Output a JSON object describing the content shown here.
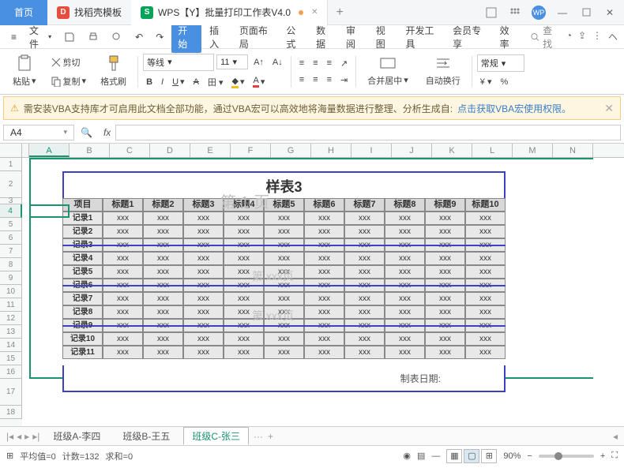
{
  "titlebar": {
    "home_tab": "首页",
    "template_tab": "找稻壳模板",
    "doc_tab": "WPS【Y】批量打印工作表V4.0",
    "avatar": "WP"
  },
  "menubar": {
    "file": "文件",
    "items": [
      "开始",
      "插入",
      "页面布局",
      "公式",
      "数据",
      "审阅",
      "视图",
      "开发工具",
      "会员专享",
      "效率"
    ],
    "search": "查找"
  },
  "ribbon": {
    "paste": "粘贴",
    "cut": "剪切",
    "copy": "复制",
    "format_painter": "格式刷",
    "font_family": "等线",
    "font_size": "11",
    "merge_center": "合并居中",
    "auto_wrap": "自动换行",
    "general": "常规"
  },
  "warning": {
    "text": "需安装VBA支持库才可启用此文档全部功能，通过VBA宏可以高效地将海量数据进行整理、分析生成自:",
    "link": "点击获取VBA宏使用权限。"
  },
  "fxbar": {
    "cell_ref": "A4"
  },
  "grid": {
    "cols": [
      "A",
      "B",
      "C",
      "D",
      "E",
      "F",
      "G",
      "H",
      "I",
      "J",
      "K",
      "L",
      "M",
      "N"
    ],
    "title": "样表3",
    "watermark_top": "第 1 页",
    "watermark_mid1": "第 xxx页",
    "watermark_mid2": "第 xxx页",
    "headers": [
      "项目",
      "标题1",
      "标题2",
      "标题3",
      "标题4",
      "标题5",
      "标题6",
      "标题7",
      "标题8",
      "标题9",
      "标题10"
    ],
    "records": [
      "记录1",
      "记录2",
      "记录3",
      "记录4",
      "记录5",
      "记录6",
      "记录7",
      "记录8",
      "记录9",
      "记录10",
      "记录11"
    ],
    "cell_value": "xxx",
    "footer_label": "制表日期:"
  },
  "sheets": {
    "tab1": "班级A-李四",
    "tab2": "班级B-王五",
    "tab3": "班级C-张三"
  },
  "status": {
    "avg": "平均值=0",
    "count": "计数=132",
    "sum": "求和=0",
    "zoom": "90%"
  }
}
